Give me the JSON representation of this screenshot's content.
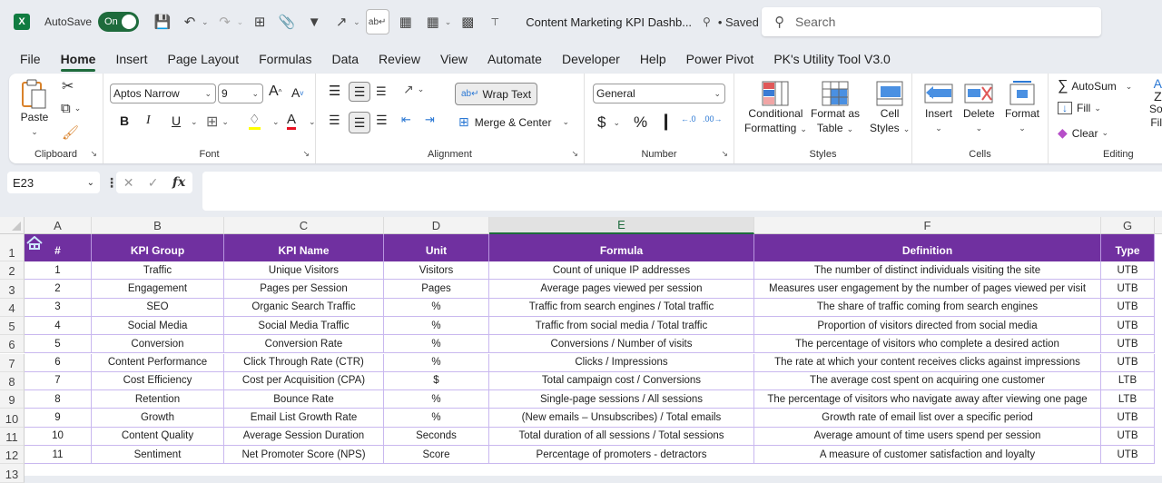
{
  "titlebar": {
    "app_icon": "excel-icon",
    "autosave_label": "AutoSave",
    "autosave_state": "On",
    "document_title": "Content Marketing KPI Dashb...",
    "save_status": "• Saved",
    "search_placeholder": "Search"
  },
  "menu": {
    "tabs": [
      "File",
      "Home",
      "Insert",
      "Page Layout",
      "Formulas",
      "Data",
      "Review",
      "View",
      "Automate",
      "Developer",
      "Help",
      "Power Pivot",
      "PK's Utility Tool V3.0"
    ],
    "active": "Home"
  },
  "ribbon": {
    "clipboard": {
      "label": "Clipboard",
      "paste": "Paste"
    },
    "font": {
      "label": "Font",
      "font_name": "Aptos Narrow",
      "font_size": "9",
      "bold": "B",
      "italic": "I",
      "underline": "U",
      "grow": "A",
      "shrink": "A",
      "font_color": "A"
    },
    "alignment": {
      "label": "Alignment",
      "wrap_text": "Wrap Text",
      "merge_center": "Merge & Center"
    },
    "number": {
      "label": "Number",
      "format": "General",
      "currency": "$",
      "percent": "%",
      "comma": "9",
      "inc_decimal": "←.0 .00",
      "dec_decimal": ".00 →.0"
    },
    "styles": {
      "label": "Styles",
      "conditional_1": "Conditional",
      "conditional_2": "Formatting",
      "format_table_1": "Format as",
      "format_table_2": "Table",
      "cell_styles_1": "Cell",
      "cell_styles_2": "Styles"
    },
    "cells": {
      "label": "Cells",
      "insert": "Insert",
      "delete": "Delete",
      "format": "Format"
    },
    "editing": {
      "label": "Editing",
      "autosum": "AutoSum",
      "fill": "Fill",
      "clear": "Clear",
      "sort_1": "Sor",
      "sort_2": "Filt"
    }
  },
  "formula_bar": {
    "name_box": "E23",
    "formula": ""
  },
  "sheet": {
    "columns": [
      "A",
      "B",
      "C",
      "D",
      "E",
      "F",
      "G"
    ],
    "selected_column": "E",
    "row_numbers": [
      "1",
      "2",
      "3",
      "4",
      "5",
      "6",
      "7",
      "8",
      "9",
      "10",
      "11",
      "12",
      "13"
    ],
    "header": [
      "#",
      "KPI Group",
      "KPI Name",
      "Unit",
      "Formula",
      "Definition",
      "Type"
    ],
    "rows": [
      [
        "1",
        "Traffic",
        "Unique Visitors",
        "Visitors",
        "Count of unique IP addresses",
        "The number of distinct individuals visiting the site",
        "UTB"
      ],
      [
        "2",
        "Engagement",
        "Pages per Session",
        "Pages",
        "Average pages viewed per session",
        "Measures user engagement by the number of pages viewed per visit",
        "UTB"
      ],
      [
        "3",
        "SEO",
        "Organic Search Traffic",
        "%",
        "Traffic from search engines / Total traffic",
        "The share of traffic coming from search engines",
        "UTB"
      ],
      [
        "4",
        "Social Media",
        "Social Media Traffic",
        "%",
        "Traffic from social media / Total traffic",
        "Proportion of visitors directed from social media",
        "UTB"
      ],
      [
        "5",
        "Conversion",
        "Conversion Rate",
        "%",
        "Conversions / Number of visits",
        "The percentage of visitors who complete a desired action",
        "UTB"
      ],
      [
        "6",
        "Content Performance",
        "Click Through Rate (CTR)",
        "%",
        "Clicks / Impressions",
        "The rate at which your content receives clicks against impressions",
        "UTB"
      ],
      [
        "7",
        "Cost Efficiency",
        "Cost per Acquisition (CPA)",
        "$",
        "Total campaign cost / Conversions",
        "The average cost spent on acquiring one customer",
        "LTB"
      ],
      [
        "8",
        "Retention",
        "Bounce Rate",
        "%",
        "Single-page sessions / All sessions",
        "The percentage of visitors who navigate away after viewing one page",
        "LTB"
      ],
      [
        "9",
        "Growth",
        "Email List Growth Rate",
        "%",
        "(New emails – Unsubscribes) / Total emails",
        "Growth rate of email list over a specific period",
        "UTB"
      ],
      [
        "10",
        "Content Quality",
        "Average Session Duration",
        "Seconds",
        "Total duration of all sessions / Total sessions",
        "Average amount of time users spend per session",
        "UTB"
      ],
      [
        "11",
        "Sentiment",
        "Net Promoter Score (NPS)",
        "Score",
        "Percentage of promoters - detractors",
        "A measure of customer satisfaction and loyalty",
        "UTB"
      ]
    ],
    "colors": {
      "header_bg": "#7030a0",
      "header_text": "#ffffff",
      "border": "#c9b8ef",
      "accent": "#1e6b3c"
    }
  }
}
